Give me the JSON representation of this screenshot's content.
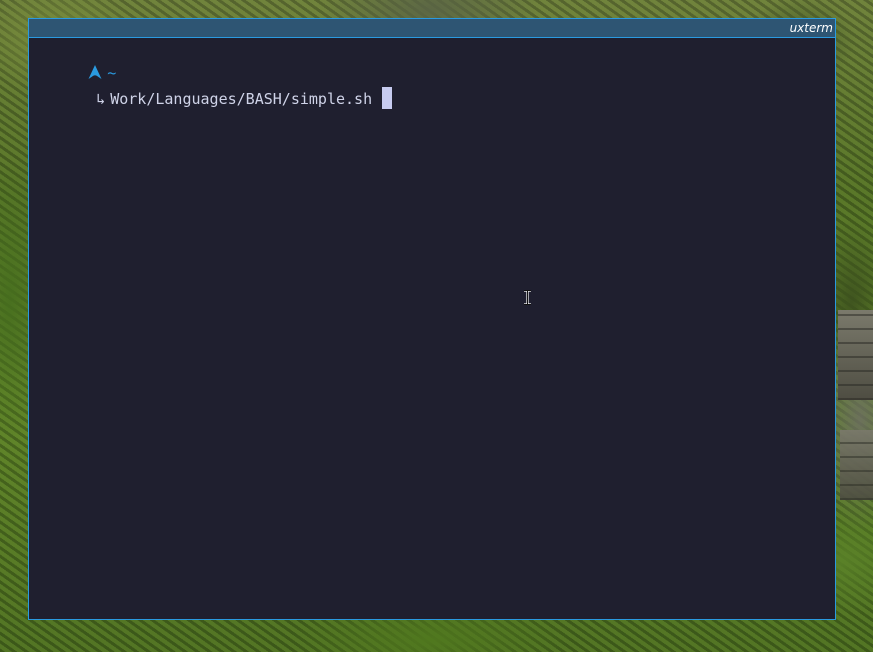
{
  "window": {
    "title": "uxterm",
    "accent_color": "#2a9ae0",
    "background_color": "#1f1f2f"
  },
  "terminal": {
    "prompt_icon": "arch-linux-icon",
    "cwd": "~",
    "continuation_symbol": "↳",
    "command_input": "Work/Languages/BASH/simple.sh"
  },
  "pointer": {
    "icon": "text-cursor-ibeam-icon"
  }
}
